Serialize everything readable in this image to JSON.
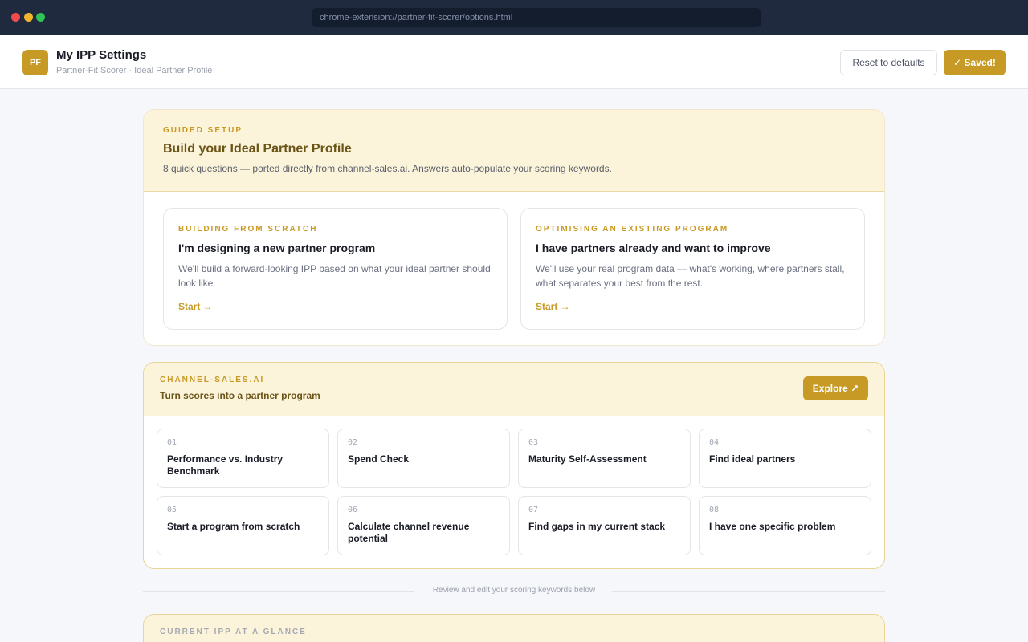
{
  "browser": {
    "url": "chrome-extension://partner-fit-scorer/options.html"
  },
  "header": {
    "logo_text": "PF",
    "title": "My IPP Settings",
    "subtitle": "Partner-Fit Scorer · Ideal Partner Profile",
    "reset_label": "Reset to defaults",
    "saved_label": "✓ Saved!"
  },
  "guided_setup": {
    "eyebrow": "GUIDED SETUP",
    "title": "Build your Ideal Partner Profile",
    "description": "8 quick questions — ported directly from channel-sales.ai. Answers auto-populate your scoring keywords.",
    "options": [
      {
        "eyebrow": "BUILDING FROM SCRATCH",
        "title": "I'm designing a new partner program",
        "description": "We'll build a forward-looking IPP based on what your ideal partner should look like.",
        "cta": "Start →"
      },
      {
        "eyebrow": "OPTIMISING AN EXISTING PROGRAM",
        "title": "I have partners already and want to improve",
        "description": "We'll use your real program data — what's working, where partners stall, what separates your best from the rest.",
        "cta": "Start →"
      }
    ]
  },
  "channel_sales": {
    "eyebrow": "CHANNEL-SALES.AI",
    "title": "Turn scores into a partner program",
    "explore_label": "Explore ↗",
    "tools": [
      {
        "num": "01",
        "label": "Performance vs. Industry Benchmark"
      },
      {
        "num": "02",
        "label": "Spend Check"
      },
      {
        "num": "03",
        "label": "Maturity Self-Assessment"
      },
      {
        "num": "04",
        "label": "Find ideal partners"
      },
      {
        "num": "05",
        "label": "Start a program from scratch"
      },
      {
        "num": "06",
        "label": "Calculate channel revenue potential"
      },
      {
        "num": "07",
        "label": "Find gaps in my current stack"
      },
      {
        "num": "08",
        "label": "I have one specific problem"
      }
    ]
  },
  "divider_text": "Review and edit your scoring keywords below",
  "current_ipp": {
    "eyebrow": "CURRENT IPP AT A GLANCE"
  },
  "colors": {
    "accent": "#c79a26",
    "accent_soft": "#fbf3da",
    "chrome": "#1f2a3e"
  }
}
